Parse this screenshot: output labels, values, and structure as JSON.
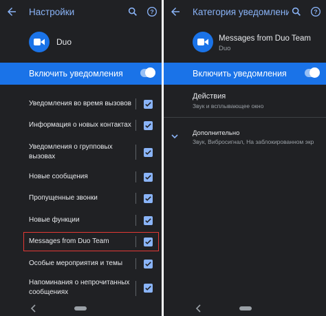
{
  "left": {
    "title": "Настройки",
    "app_name": "Duo",
    "banner_label": "Включить уведомления",
    "items": [
      {
        "label": "Уведомления во время вызовов",
        "checked": true
      },
      {
        "label": "Информация о новых контактах",
        "checked": true
      },
      {
        "label": "Уведомления о групповых вызовах",
        "checked": true
      },
      {
        "label": "Новые сообщения",
        "checked": true
      },
      {
        "label": "Пропущенные звонки",
        "checked": true
      },
      {
        "label": "Новые функции",
        "checked": true
      },
      {
        "label": "Messages from Duo Team",
        "checked": true
      },
      {
        "label": "Особые мероприятия и темы",
        "checked": true
      },
      {
        "label": "Напоминания о непрочитанных сообщениях",
        "checked": true
      }
    ]
  },
  "right": {
    "title": "Категория уведомления",
    "app_name": "Messages from Duo Team",
    "app_sub": "Duo",
    "banner_label": "Включить уведомления",
    "actions": {
      "title": "Действия",
      "subtitle": "Звук и всплывающее окно"
    },
    "advanced": {
      "title": "Дополнительно",
      "subtitle": "Звук, Вибросигнал, На заблокированном экр"
    }
  },
  "colors": {
    "background": "#202124",
    "accent": "#1a73e8",
    "accent_light": "#8ab4f8",
    "highlight": "#e53935"
  }
}
